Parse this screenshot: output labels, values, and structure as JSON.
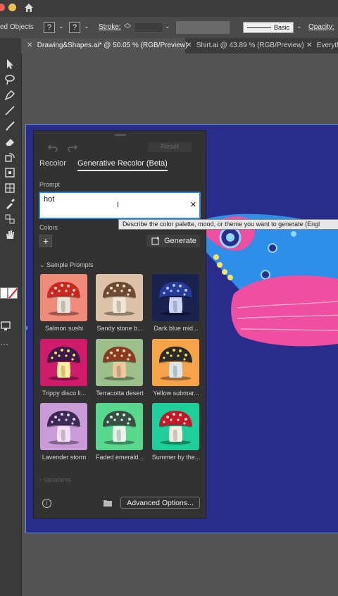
{
  "control_bar": {
    "objects_label": "ed Objects",
    "stroke_label": "Stroke:",
    "basic_label": "Basic",
    "opacity_label": "Opacity:"
  },
  "tabs": [
    {
      "label": "Drawing&Shapes.ai* @ 50.05 % (RGB/Preview)"
    },
    {
      "label": "Shirt.ai @ 43.89 % (RGB/Preview)"
    },
    {
      "label": "Everyth"
    }
  ],
  "panel": {
    "reset_label": "Reset",
    "tab_recolor": "Recolor",
    "tab_generative": "Generative Recolor (Beta)",
    "prompt_label": "Prompt",
    "prompt_value": "hot",
    "colors_label": "Colors",
    "generate_label": "Generate",
    "sample_prompts_label": "Sample Prompts",
    "variations_label": "Variations",
    "advanced_label": "Advanced Options...",
    "samples": [
      {
        "caption": "Salmon sushi",
        "bg": "#f08a7a",
        "cap": "#c8281e",
        "dots": "#ffd9c8",
        "stem": "#e8e4d8"
      },
      {
        "caption": "Sandy stone b...",
        "bg": "#dcc2a6",
        "cap": "#6e4a33",
        "dots": "#f3e3cc",
        "stem": "#f0e6d4"
      },
      {
        "caption": "Dark blue mid...",
        "bg": "#1a2350",
        "cap": "#263a9a",
        "dots": "#b9c8ff",
        "stem": "#cfd6f5"
      },
      {
        "caption": "Trippy disco li...",
        "bg": "#d01a6a",
        "cap": "#3b1a4a",
        "dots": "#ffe168",
        "stem": "#ffef9a"
      },
      {
        "caption": "Terracotta desert",
        "bg": "#9cc08a",
        "cap": "#8a3a22",
        "dots": "#f4d6a8",
        "stem": "#f1c79e"
      },
      {
        "caption": "Yellow submar...",
        "bg": "#f7a34a",
        "cap": "#2a2a2a",
        "dots": "#f7d84a",
        "stem": "#d9e8ef"
      },
      {
        "caption": "Lavender storm",
        "bg": "#c99bd8",
        "cap": "#3c2a52",
        "dots": "#e9c8ff",
        "stem": "#f1e0f7"
      },
      {
        "caption": "Faded emerald...",
        "bg": "#58d88c",
        "cap": "#3a4f44",
        "dots": "#cfeedd",
        "stem": "#eaf4ee"
      },
      {
        "caption": "Summer by the...",
        "bg": "#1fcf9a",
        "cap": "#c2182a",
        "dots": "#ffe1c4",
        "stem": "#f6efe1"
      }
    ]
  },
  "tooltip": "Describe the color palette, mood, or theme you want to generate (Engl",
  "colors": {
    "artboard": "#282d8c",
    "panel": "#323232",
    "accent_blue": "#2e8ae6"
  }
}
